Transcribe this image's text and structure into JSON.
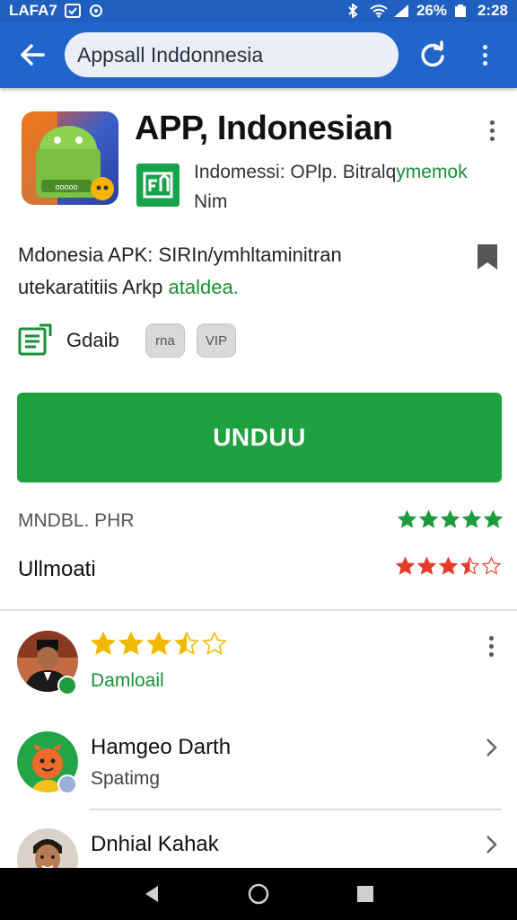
{
  "status_bar": {
    "left_text": "LAFA7",
    "battery_percent": "26%",
    "time": "2:28"
  },
  "app_bar": {
    "search_text": "Appsall Inddonnesia",
    "icons": [
      "back-arrow-icon",
      "refresh-icon",
      "overflow-menu-icon"
    ]
  },
  "app": {
    "title": "APP, Indonesian",
    "developer_line1": "Indomessi: OPlp. Bitralq",
    "developer_line1_green": "ymemok",
    "developer_line2": "Nim",
    "description_line1": "Mdonesia APK: SIRIn/ymhltaminitran",
    "description_line2": "utekaratitiis Arkp",
    "description_line2_green": "ataldea.",
    "category_label": "Gdaib",
    "chips": [
      "rna",
      "VIP"
    ],
    "download_label": "UNDUU"
  },
  "ratings": [
    {
      "label": "MNDBL. PHR",
      "stars": 5,
      "star_color": "#1e9b3c"
    },
    {
      "label": "Ullmoati",
      "stars": 3.5,
      "star_color": "#e83a2a"
    }
  ],
  "reviews": {
    "first": {
      "stars": 3.5,
      "star_color": "#f0b800",
      "sub": "Damloail"
    },
    "items": [
      {
        "title": "Hamgeo Darth",
        "sub": "Spatimg"
      },
      {
        "title": "Dnhial Kahak",
        "sub": ""
      }
    ]
  },
  "colors": {
    "app_bar": "#2065cc",
    "accent_green": "#1ea13f"
  }
}
